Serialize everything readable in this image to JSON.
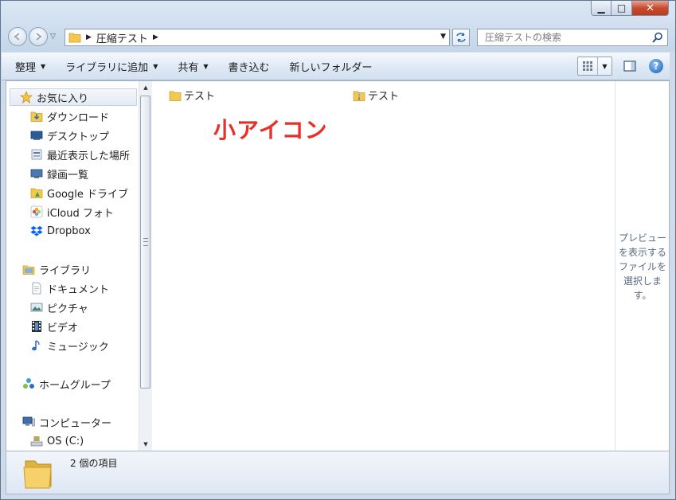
{
  "window": {
    "caption_buttons": {
      "minimize": "▁",
      "maximize": "□",
      "close": "✕"
    }
  },
  "address": {
    "path": "圧縮テスト"
  },
  "search": {
    "placeholder": "圧縮テストの検索"
  },
  "toolbar": {
    "organize": "整理",
    "include_in_library": "ライブラリに追加",
    "share": "共有",
    "burn": "書き込む",
    "new_folder": "新しいフォルダー"
  },
  "nav": {
    "favorites": "お気に入り",
    "favorites_items": [
      "ダウンロード",
      "デスクトップ",
      "最近表示した場所",
      "録画一覧",
      "Google ドライブ",
      "iCloud フォト",
      "Dropbox"
    ],
    "libraries": "ライブラリ",
    "libraries_items": [
      "ドキュメント",
      "ピクチャ",
      "ビデオ",
      "ミュージック"
    ],
    "homegroup": "ホームグループ",
    "computer": "コンピューター",
    "computer_items": [
      "OS (C:)"
    ]
  },
  "files": [
    {
      "name": "テスト",
      "type": "folder"
    },
    {
      "name": "テスト",
      "type": "zip-folder"
    }
  ],
  "overlay_label": "小アイコン",
  "preview": {
    "message": "プレビューを表示するファイルを選択します。"
  },
  "details": {
    "count": "2 個の項目"
  },
  "colors": {
    "overlay_red": "#e8302a",
    "folder_yellow": "#f2c94c"
  }
}
